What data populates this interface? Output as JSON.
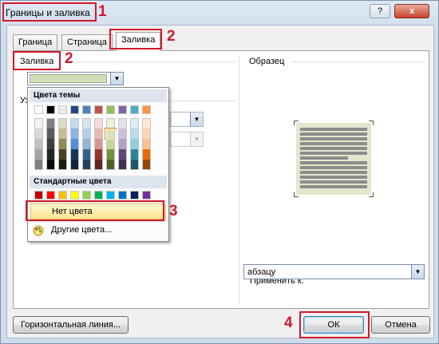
{
  "window": {
    "title": "Границы и заливка",
    "help_label": "?",
    "close_label": "x"
  },
  "tabs": [
    {
      "label": "Граница",
      "active": false
    },
    {
      "label": "Страница",
      "active": false
    },
    {
      "label": "Заливка",
      "active": true
    }
  ],
  "fill": {
    "section_title": "Заливка",
    "current_color": "#d3e0b7"
  },
  "pattern": {
    "section_title_partial": "Уз"
  },
  "color_popup": {
    "theme_header": "Цвета темы",
    "theme_top_row": [
      "#ffffff",
      "#000000",
      "#eeece1",
      "#1f497d",
      "#4f81bd",
      "#c0504d",
      "#9bbb59",
      "#8064a2",
      "#4bacc6",
      "#f79646"
    ],
    "theme_shades": [
      [
        "#f2f2f2",
        "#d8d8d8",
        "#bfbfbf",
        "#a5a5a5",
        "#7f7f7f"
      ],
      [
        "#7f7f7f",
        "#595959",
        "#3f3f3f",
        "#262626",
        "#0c0c0c"
      ],
      [
        "#ddd9c3",
        "#c4bd97",
        "#938953",
        "#494429",
        "#1d1b10"
      ],
      [
        "#c6d9f0",
        "#8db3e2",
        "#548dd4",
        "#17365d",
        "#0f243e"
      ],
      [
        "#dbe5f1",
        "#b8cce4",
        "#95b3d7",
        "#366092",
        "#244061"
      ],
      [
        "#f2dcdb",
        "#e5b9b7",
        "#d99694",
        "#953734",
        "#632423"
      ],
      [
        "#ebf1dd",
        "#d7e3bc",
        "#c3d69b",
        "#76923c",
        "#4f6128"
      ],
      [
        "#e5e0ec",
        "#ccc1d9",
        "#b2a2c7",
        "#5f497a",
        "#3f3151"
      ],
      [
        "#dbeef3",
        "#b7dde8",
        "#92cddc",
        "#31859b",
        "#205867"
      ],
      [
        "#fdeada",
        "#fbd5b5",
        "#fac08f",
        "#e36c09",
        "#974806"
      ]
    ],
    "standard_header": "Стандартные цвета",
    "standard_colors": [
      "#c00000",
      "#ff0000",
      "#ffc000",
      "#ffff00",
      "#92d050",
      "#00b050",
      "#00b0f0",
      "#0070c0",
      "#002060",
      "#7030a0"
    ],
    "no_color_label": "Нет цвета",
    "more_colors_label": "Другие цвета..."
  },
  "preview": {
    "title": "Образец",
    "apply_to_label": "Применить к:",
    "apply_to_value": "абзацу"
  },
  "buttons": {
    "horizontal_line": "Горизонтальная линия...",
    "ok": "ОК",
    "cancel": "Отмена"
  },
  "annotations": {
    "step1": "1",
    "step2": "2",
    "step3": "3",
    "step4": "4",
    "color": "#d0192b"
  }
}
